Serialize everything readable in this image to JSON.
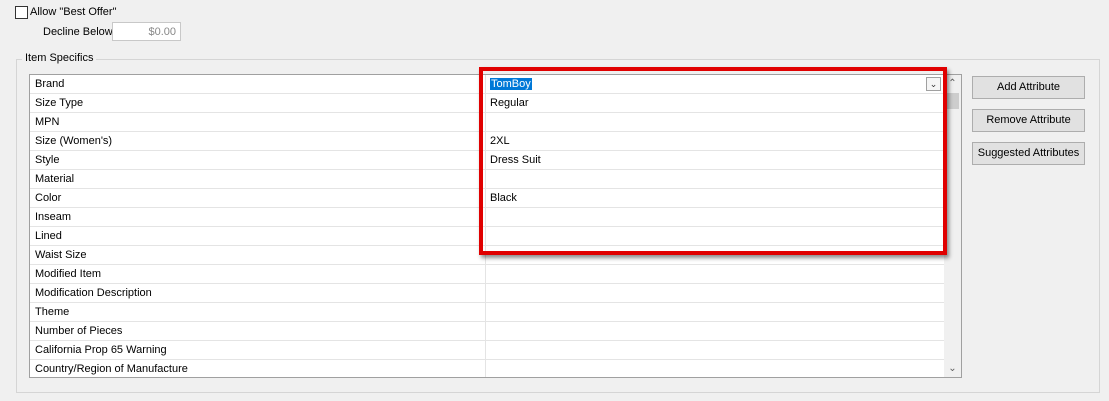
{
  "best_offer": {
    "allow_label": "Allow \"Best Offer\"",
    "checked": false,
    "decline_label": "Decline Below",
    "decline_value": "$0.00"
  },
  "item_specifics": {
    "title": "Item Specifics",
    "rows": [
      {
        "name": "Brand",
        "value": "TomBoy"
      },
      {
        "name": "Size Type",
        "value": "Regular"
      },
      {
        "name": "MPN",
        "value": ""
      },
      {
        "name": "Size (Women's)",
        "value": "2XL"
      },
      {
        "name": "Style",
        "value": "Dress Suit"
      },
      {
        "name": "Material",
        "value": ""
      },
      {
        "name": "Color",
        "value": "Black"
      },
      {
        "name": "Inseam",
        "value": ""
      },
      {
        "name": "Lined",
        "value": ""
      },
      {
        "name": "Waist Size",
        "value": ""
      },
      {
        "name": "Modified Item",
        "value": ""
      },
      {
        "name": "Modification Description",
        "value": ""
      },
      {
        "name": "Theme",
        "value": ""
      },
      {
        "name": "Number of Pieces",
        "value": ""
      },
      {
        "name": "California Prop 65 Warning",
        "value": ""
      },
      {
        "name": "Country/Region of Manufacture",
        "value": ""
      }
    ]
  },
  "buttons": {
    "add": "Add Attribute",
    "remove": "Remove Attribute",
    "suggested": "Suggested Attributes"
  },
  "icons": {
    "dropdown": "chevron-down-icon",
    "scroll_up": "chevron-up-icon",
    "scroll_down": "chevron-down-icon"
  },
  "colors": {
    "highlight": "#e00000",
    "selection": "#0078d7"
  }
}
